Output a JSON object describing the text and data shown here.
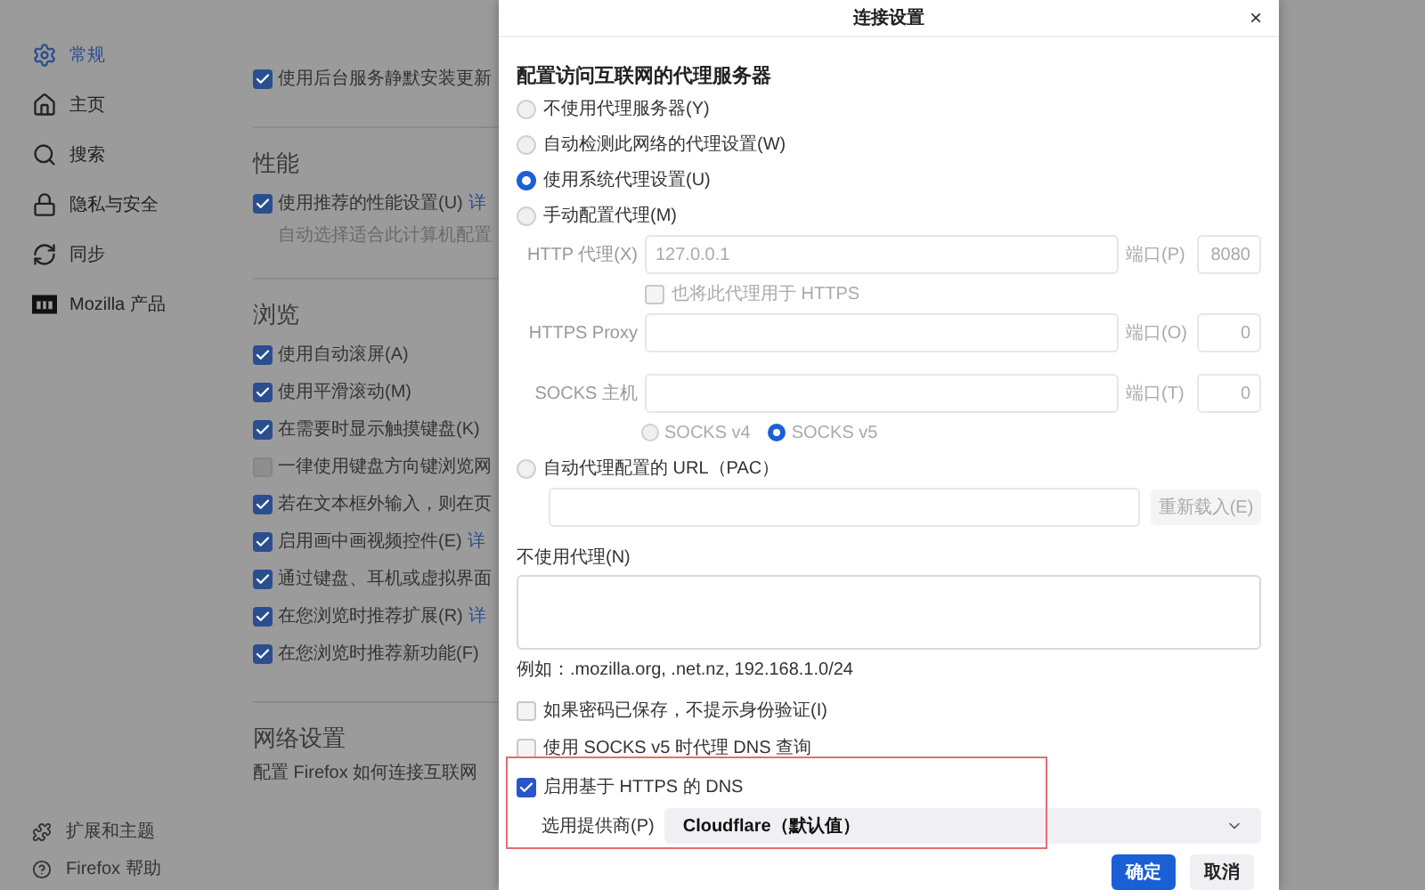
{
  "sidebar": {
    "items": [
      {
        "label": "常规",
        "selected": true
      },
      {
        "label": "主页",
        "selected": false
      },
      {
        "label": "搜索",
        "selected": false
      },
      {
        "label": "隐私与安全",
        "selected": false
      },
      {
        "label": "同步",
        "selected": false
      },
      {
        "label": "Mozilla 产品",
        "selected": false
      }
    ],
    "footer_items": [
      {
        "label": "扩展和主题"
      },
      {
        "label": "Firefox 帮助"
      }
    ]
  },
  "content": {
    "sections": [
      {
        "rows": [
          {
            "label": "使用后台服务静默安装更新",
            "checked": true
          }
        ]
      },
      {
        "title": "性能",
        "rows": [
          {
            "label": "使用推荐的性能设置(U)",
            "checked": true,
            "link": "详",
            "note": "自动选择适合此计算机配置"
          }
        ]
      },
      {
        "title": "浏览",
        "rows": [
          {
            "label": "使用自动滚屏(A)",
            "checked": true
          },
          {
            "label": "使用平滑滚动(M)",
            "checked": true
          },
          {
            "label": "在需要时显示触摸键盘(K)",
            "checked": true
          },
          {
            "label": "一律使用键盘方向键浏览网",
            "checked": false
          },
          {
            "label": "若在文本框外输入，则在页",
            "checked": true
          },
          {
            "label": "启用画中画视频控件(E)",
            "checked": true,
            "link": "详"
          },
          {
            "label": "通过键盘、耳机或虚拟界面",
            "checked": true
          },
          {
            "label": "在您浏览时推荐扩展(R)",
            "checked": true,
            "link": "详"
          },
          {
            "label": "在您浏览时推荐新功能(F)",
            "checked": true
          }
        ]
      },
      {
        "title": "网络设置",
        "description": "配置 Firefox 如何连接互联网"
      }
    ]
  },
  "dialog": {
    "title": "连接设置",
    "close": "×",
    "heading": "配置访问互联网的代理服务器",
    "proxy_modes": [
      {
        "label": "不使用代理服务器(Y)",
        "selected": false
      },
      {
        "label": "自动检测此网络的代理设置(W)",
        "selected": false
      },
      {
        "label": "使用系统代理设置(U)",
        "selected": true
      },
      {
        "label": "手动配置代理(M)",
        "selected": false
      }
    ],
    "http": {
      "label": "HTTP 代理(X)",
      "value": "127.0.0.1",
      "port_label": "端口(P)",
      "port": "8080"
    },
    "share": {
      "label": "也将此代理用于 HTTPS",
      "checked": false
    },
    "https": {
      "label": "HTTPS Proxy",
      "port_label": "端口(O)",
      "port": "0"
    },
    "socks": {
      "label": "SOCKS 主机",
      "port_label": "端口(T)",
      "port": "0"
    },
    "socks_versions": [
      {
        "label": "SOCKS v4",
        "selected": false
      },
      {
        "label": "SOCKS v5",
        "selected": true
      }
    ],
    "pac": {
      "label": "自动代理配置的 URL（PAC）",
      "selected": false,
      "button": "重新载入(E)"
    },
    "no_proxy": {
      "label": "不使用代理(N)",
      "example": "例如：.mozilla.org, .net.nz, 192.168.1.0/24"
    },
    "options": [
      {
        "label": "如果密码已保存，不提示身份验证(I)",
        "checked": false
      },
      {
        "label": "使用 SOCKS v5 时代理 DNS 查询",
        "checked": false
      }
    ],
    "dns": {
      "label": "启用基于 HTTPS 的 DNS",
      "checked": true,
      "highlighted": true,
      "provider_label": "选用提供商(P)",
      "provider": "Cloudflare（默认值）"
    },
    "buttons": [
      {
        "label": "确定",
        "primary": true
      },
      {
        "label": "取消",
        "primary": false
      }
    ]
  }
}
